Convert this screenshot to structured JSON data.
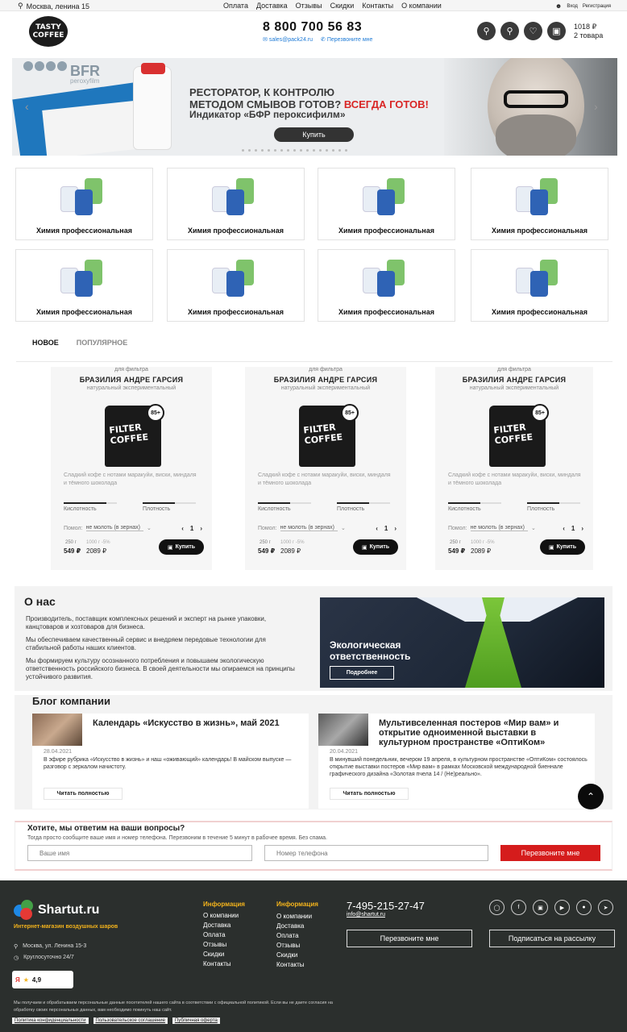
{
  "topbar": {
    "city": "Москва, ленина 15",
    "nav": [
      "Оплата",
      "Доставка",
      "Отзывы",
      "Скидки",
      "Контакты",
      "О компании"
    ],
    "login": "Вход",
    "register": "Регистрация"
  },
  "header": {
    "logo_line1": "TASTY",
    "logo_line2": "COFFEE",
    "phone": "8 800 700 56 83",
    "email": "sales@pack24.ru",
    "callback": "Перезвоните мне",
    "cart_sum": "1018 ₽",
    "cart_count": "2 товара"
  },
  "banner": {
    "brand": "BFR",
    "brand_sub": "peroxyfilm",
    "headline1": "РЕСТОРАТОР, К КОНТРОЛЮ",
    "headline2": "МЕТОДОМ СМЫВОВ ГОТОВ?",
    "headline_red": "ВСЕГДА ГОТОВ!",
    "headline3": "Индикатор «БФР пероксифилм»",
    "button": "Купить"
  },
  "categories": [
    "Химия профессиональная",
    "Химия профессиональная",
    "Химия профессиональная",
    "Химия профессиональная",
    "Химия профессиональная",
    "Химия профессиональная",
    "Химия профессиональная",
    "Химия профессиональная"
  ],
  "tabs": {
    "new": "НОВОЕ",
    "popular": "ПОПУЛЯРНОЕ"
  },
  "products": [
    {
      "for": "для фильтра",
      "name": "БРАЗИЛИЯ АНДРЕ ГАРСИЯ",
      "sub": "натуральный экспериментальный",
      "bag_text1": "FILTER",
      "bag_text2": "COFFEE",
      "badge": "85+",
      "desc": "Сладкий кофе с нотами маракуйи, виски, миндаля и тёмного шоколада",
      "acidity_label": "Кислотность",
      "acidity": 0.8,
      "density_label": "Плотность",
      "density": 0.6,
      "grind_label": "Помол:",
      "grind_value": "не молоть (в зернах)",
      "qty": "1",
      "w1": "250 г",
      "w2": "1000 г",
      "w3": "-5%",
      "price1": "549 ₽",
      "price2": "2089 ₽",
      "buy": "Купить"
    },
    {
      "for": "для фильтра",
      "name": "БРАЗИЛИЯ АНДРЕ ГАРСИЯ",
      "sub": "натуральный экспериментальный",
      "bag_text1": "FILTER",
      "bag_text2": "COFFEE",
      "badge": "85+",
      "desc": "Сладкий кофе с нотами маракуйи, виски, миндаля и тёмного шоколада",
      "acidity_label": "Кислотность",
      "acidity": 0.6,
      "density_label": "Плотность",
      "density": 0.6,
      "grind_label": "Помол:",
      "grind_value": "не молоть (в зернах)",
      "qty": "1",
      "w1": "250 г",
      "w2": "1000 г",
      "w3": "-5%",
      "price1": "549 ₽",
      "price2": "2089 ₽",
      "buy": "Купить"
    },
    {
      "for": "для фильтра",
      "name": "БРАЗИЛИЯ АНДРЕ ГАРСИЯ",
      "sub": "натуральный экспериментальный",
      "bag_text1": "FILTER",
      "bag_text2": "COFFEE",
      "badge": "85+",
      "desc": "Сладкий кофе с нотами маракуйи, виски, миндаля и тёмного шоколада",
      "acidity_label": "Кислотность",
      "acidity": 0.6,
      "density_label": "Плотность",
      "density": 0.6,
      "grind_label": "Помол:",
      "grind_value": "не молоть (в зернах)",
      "qty": "1",
      "w1": "250 г",
      "w2": "1000 г",
      "w3": "-5%",
      "price1": "549 ₽",
      "price2": "2089 ₽",
      "buy": "Купить"
    }
  ],
  "about": {
    "title": "О нас",
    "p1": "Производитель, поставщик комплексных решений и эксперт на рынке упаковки, канцтоваров и хозтоваров для бизнеса.",
    "p2": "Мы обеспечиваем качественный сервис и внедряем передовые технологии для стабильной работы наших клиентов.",
    "p3": "Мы формируем культуру осознанного потребления и повышаем экологическую ответственность российского бизнеса. В своей деятельности мы опираемся на принципы устойчивого развития.",
    "eco_title1": "Экологическая",
    "eco_title2": "ответственность",
    "eco_button": "Подробнее"
  },
  "blog": {
    "title": "Блог компании",
    "posts": [
      {
        "title": "Календарь «Искусство в жизнь», май 2021",
        "date": "28.04.2021",
        "text": "В эфире рубрика «Искусство в жизнь» и наш «оживающий» календарь! В майском выпуске — разговор с зеркалом начистоту.",
        "button": "Читать полностью"
      },
      {
        "title": "Мультивселенная постеров «Мир вам» и открытие одноименной выставки в культурном пространстве «ОптиКом»",
        "date": "20.04.2021",
        "text": "В минувший понедельник, вечером 19 апреля, в культурном пространстве «ОптиКом» состоялось открытие выставки постеров «Мир вам» в рамках Московской международной биеннале графического дизайна «Золотая пчела 14 / (Не)реально».",
        "button": "Читать полностью"
      }
    ]
  },
  "callback": {
    "title": "Хотите, мы ответим на ваши вопросы?",
    "subtitle": "Тогда просто сообщите ваше имя и номер телефона. Перезвоним в течение 5 минут в рабочее время. Без спама.",
    "name_placeholder": "Ваше имя",
    "phone_placeholder": "Номер телефона",
    "button": "Перезвоните мне"
  },
  "footer": {
    "brand": "Shartut.ru",
    "slogan": "Интернет-магазин воздушных шаров",
    "address": "Москва, ул. Ленина 15-3",
    "hours": "Круглосуточно 24/7",
    "rating": "4,9",
    "col1_title": "Информация",
    "col1": [
      "О компании",
      "Доставка",
      "Оплата",
      "Отзывы",
      "Скидки",
      "Контакты"
    ],
    "col2_title": "Информация",
    "col2": [
      "О компании",
      "Доставка",
      "Оплата",
      "Отзывы",
      "Скидки",
      "Контакты"
    ],
    "phone": "7-495-215-27-47",
    "email": "info@shartut.ru",
    "callback": "Перезвоните мне",
    "subscribe": "Подписаться на рассылку",
    "note": "Мы получаем и обрабатываем персональные данные посетителей нашего сайта в соответствии с официальной политикой. Если вы не даете согласия на обработку своих персональных данных, вам необходимо покинуть наш сайт.",
    "links": [
      "Политика конфиденциальности",
      "Пользовательское соглашение",
      "Публичная оферта"
    ]
  },
  "colors": {
    "accent_red": "#d51c1c",
    "footer_bg": "#2b2f2d",
    "footer_accent": "#f3b31c",
    "link_blue": "#1f7bd6"
  }
}
